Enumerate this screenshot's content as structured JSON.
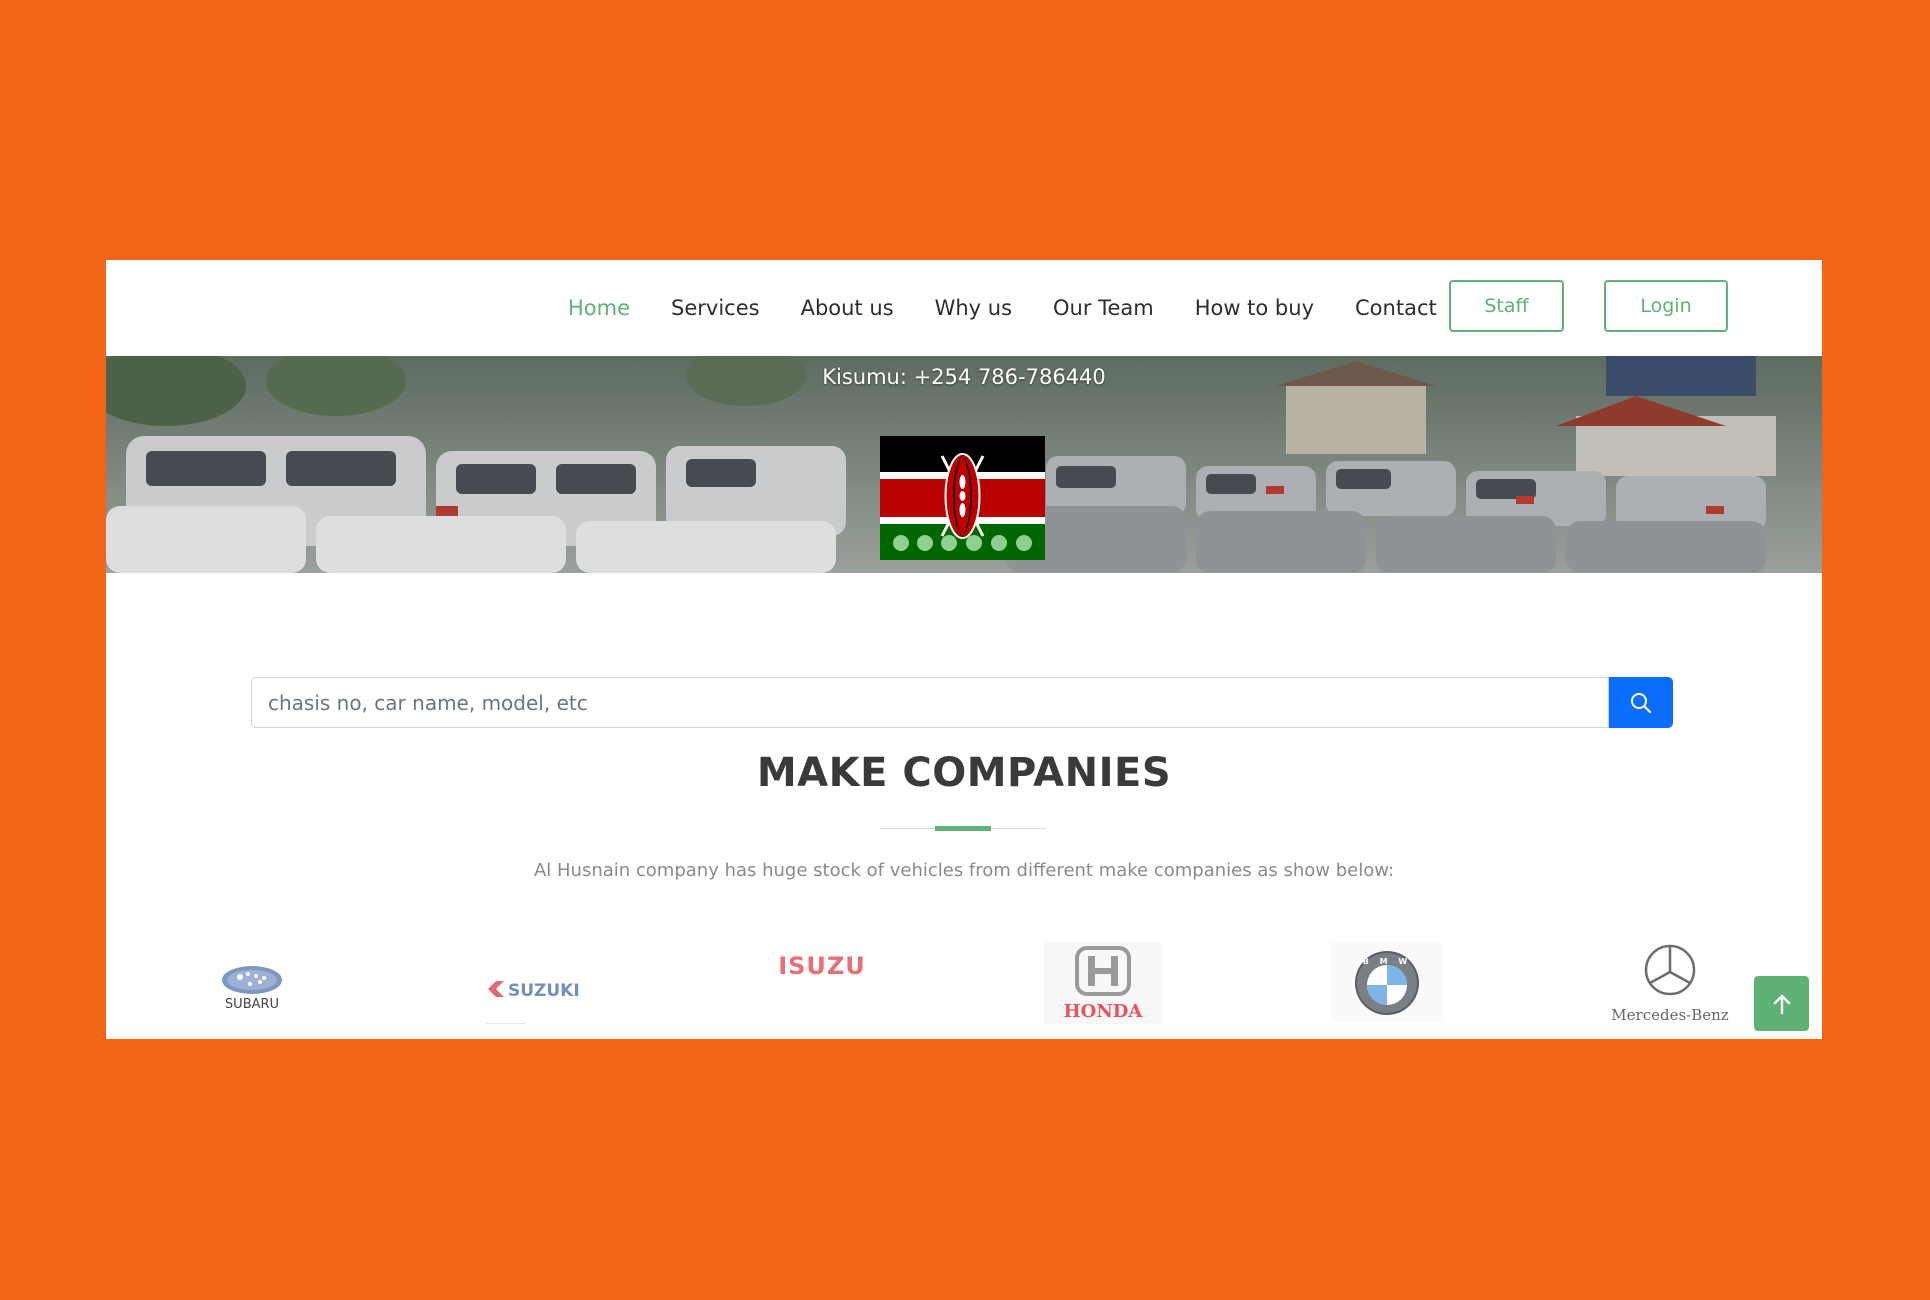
{
  "nav": {
    "items": [
      {
        "label": "Home",
        "active": true
      },
      {
        "label": "Services",
        "active": false
      },
      {
        "label": "About us",
        "active": false
      },
      {
        "label": "Why us",
        "active": false
      },
      {
        "label": "Our Team",
        "active": false
      },
      {
        "label": "How to buy",
        "active": false
      },
      {
        "label": "Contact",
        "active": false
      }
    ],
    "staff_label": "Staff",
    "login_label": "Login"
  },
  "hero": {
    "phone": "Kisumu: +254 786-786440",
    "flag_icon": "kenya-flag-icon"
  },
  "search": {
    "placeholder": "chasis no, car name, model, etc",
    "value": "",
    "button_icon": "search-icon"
  },
  "section": {
    "title": "MAKE COMPANIES",
    "description": "Al Husnain company has huge stock of vehicles from different make companies as show below:"
  },
  "brands": {
    "subaru": "SUBARU",
    "suzuki": "SUZUKI",
    "isuzu": "ISUZU",
    "honda": "HONDA",
    "bmw": "B M W",
    "mercedes": "Mercedes-Benz"
  },
  "colors": {
    "accent": "#5fb276",
    "primary": "#0d6efd",
    "page_background": "#f26516"
  },
  "scroll_top_icon": "arrow-up-icon"
}
